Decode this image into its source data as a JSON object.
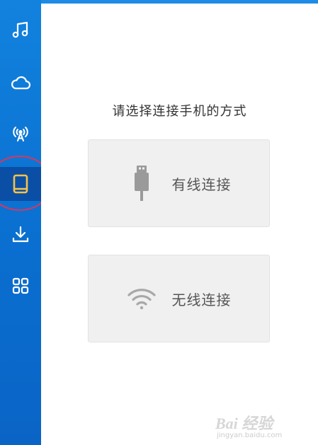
{
  "sidebar": {
    "items": [
      {
        "id": "music",
        "icon": "music-note-icon",
        "active": false
      },
      {
        "id": "cloud",
        "icon": "cloud-icon",
        "active": false
      },
      {
        "id": "signal",
        "icon": "broadcast-tower-icon",
        "active": false
      },
      {
        "id": "device",
        "icon": "tablet-icon",
        "active": true
      },
      {
        "id": "download",
        "icon": "download-icon",
        "active": false
      },
      {
        "id": "apps",
        "icon": "apps-grid-icon",
        "active": false
      }
    ],
    "active_icon_color": "#f6c24a",
    "icon_color": "#ffffff"
  },
  "main": {
    "prompt": "请选择连接手机的方式",
    "options": [
      {
        "id": "wired",
        "label": "有线连接",
        "icon": "usb-cable-icon"
      },
      {
        "id": "wireless",
        "label": "无线连接",
        "icon": "wifi-icon"
      }
    ]
  },
  "watermark": {
    "logo": "Bai 经验",
    "sub": "jingyan.baidu.com"
  },
  "colors": {
    "sidebar_bg": "#0a6fd0",
    "highlight_ring": "#d8365f",
    "card_bg": "#f0f0f0"
  }
}
